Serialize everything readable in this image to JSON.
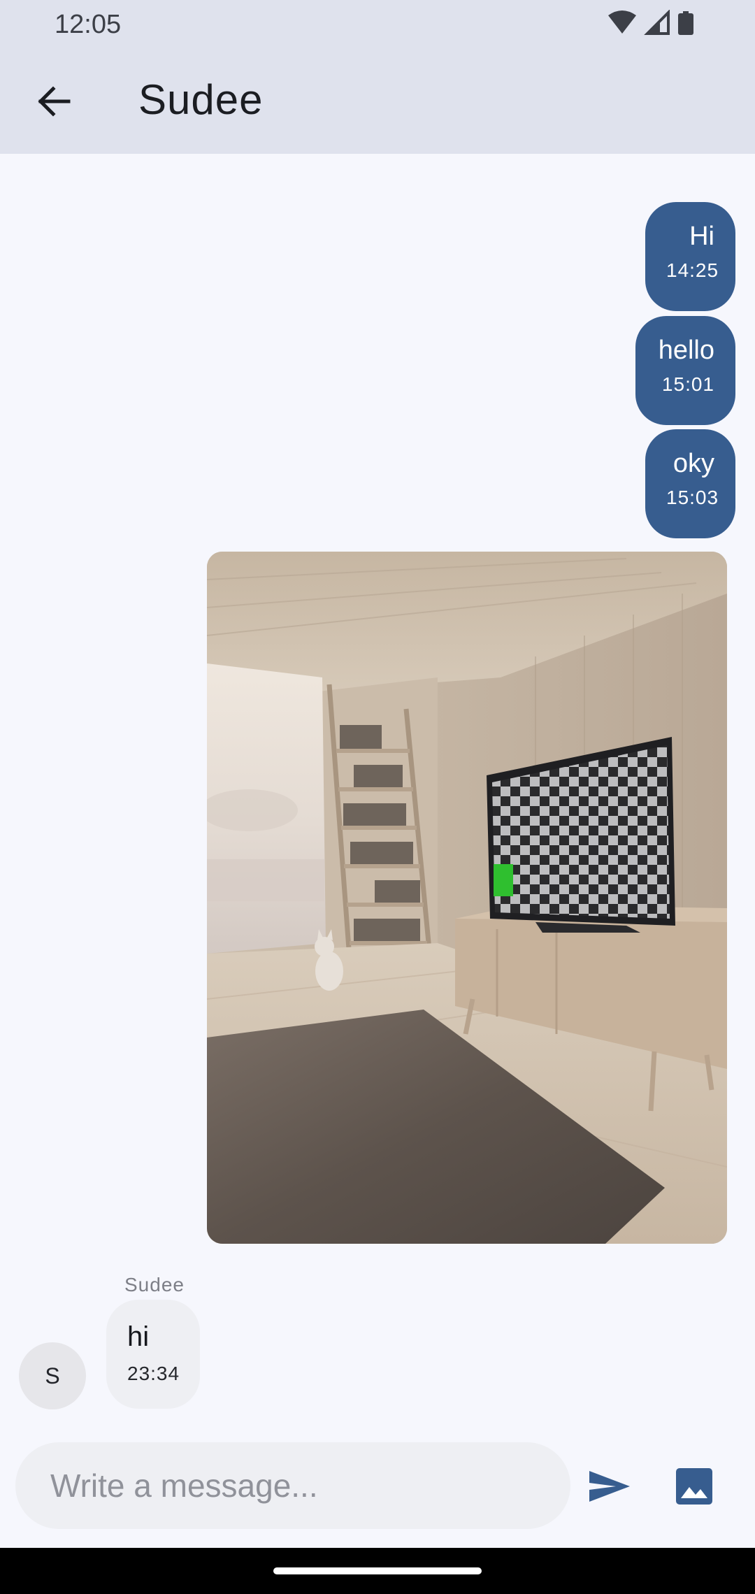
{
  "status_bar": {
    "time": "12:05",
    "icons": [
      "wifi-icon",
      "cellular-signal-icon",
      "battery-icon"
    ]
  },
  "header": {
    "title": "Sudee",
    "back_icon": "arrow-left-icon"
  },
  "messages": [
    {
      "direction": "outgoing",
      "text": "Hi",
      "time": "14:25"
    },
    {
      "direction": "outgoing",
      "text": "hello",
      "time": "15:01"
    },
    {
      "direction": "outgoing",
      "text": "oky",
      "time": "15:03"
    },
    {
      "direction": "outgoing",
      "type": "image"
    },
    {
      "direction": "incoming",
      "sender": "Sudee",
      "avatar_initial": "S",
      "text": "hi",
      "time": "23:34"
    }
  ],
  "composer": {
    "placeholder": "Write a message...",
    "send_icon": "send-icon",
    "attach_image_icon": "image-icon"
  },
  "colors": {
    "app_bar_bg": "#dfe2ed",
    "screen_bg": "#f6f7fd",
    "outgoing_bubble": "#375d8f",
    "incoming_bubble": "#eeeff3",
    "accent": "#375d8f"
  }
}
